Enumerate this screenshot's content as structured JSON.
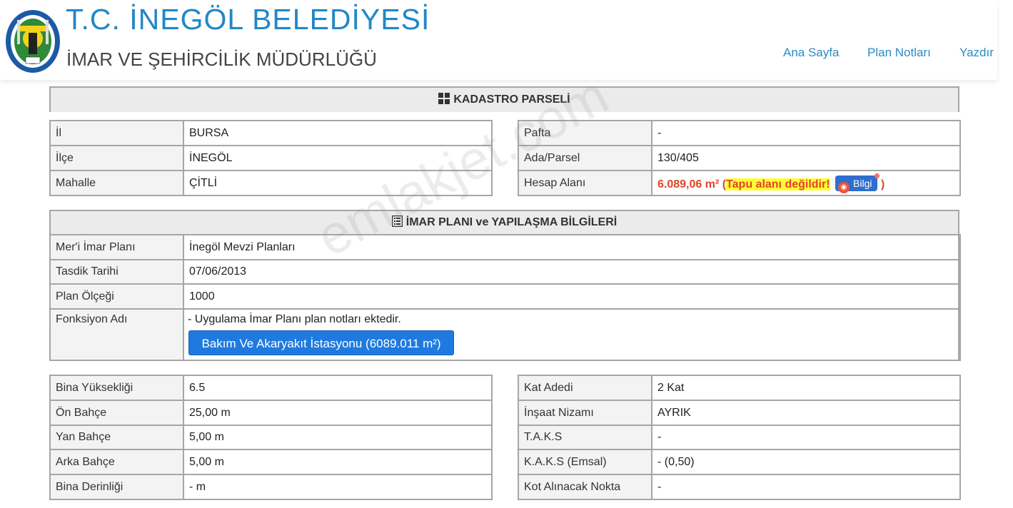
{
  "header": {
    "title": "T.C. İNEGÖL BELEDİYESİ",
    "subtitle": "İMAR VE ŞEHİRCİLİK MÜDÜRLÜĞÜ",
    "logo_text": "İNEGÖL BELEDİYESİ 1870",
    "nav": {
      "home": "Ana Sayfa",
      "notes": "Plan Notları",
      "print": "Yazdır"
    }
  },
  "kadastro": {
    "title": "KADASTRO PARSELİ",
    "left": [
      {
        "label": "İl",
        "value": "BURSA"
      },
      {
        "label": "İlçe",
        "value": "İNEGÖL"
      },
      {
        "label": "Mahalle",
        "value": "ÇİTLİ"
      }
    ],
    "right": {
      "pafta_label": "Pafta",
      "pafta_value": "-",
      "ada_label": "Ada/Parsel",
      "ada_value": "130/405",
      "hesap_label": "Hesap Alanı",
      "hesap_value": "6.089,06 m²",
      "open_paren": "(",
      "warning": "Tapu alanı değildir!",
      "info_button": "Bilgi",
      "close_paren": ")"
    }
  },
  "imar": {
    "title": "İMAR PLANI ve YAPILAŞMA BİLGİLERİ",
    "rows": [
      {
        "label": "Mer'i İmar Planı",
        "value": "İnegöl Mevzi Planları"
      },
      {
        "label": "Tasdik Tarihi",
        "value": "07/06/2013"
      },
      {
        "label": "Plan Ölçeği",
        "value": "1000"
      }
    ],
    "fonksiyon_label": "Fonksiyon Adı",
    "fonksiyon_text": "- Uygulama İmar Planı plan notları ektedir.",
    "fonksiyon_button": "Bakım Ve Akaryakıt İstasyonu (6089.011 m²)"
  },
  "yapilasma": {
    "left": [
      {
        "label": "Bina Yüksekliği",
        "value": "6.5"
      },
      {
        "label": "Ön Bahçe",
        "value": "25,00 m"
      },
      {
        "label": "Yan Bahçe",
        "value": "5,00 m"
      },
      {
        "label": "Arka Bahçe",
        "value": "5,00 m"
      },
      {
        "label": "Bina Derinliği",
        "value": "- m"
      }
    ],
    "right": [
      {
        "label": "Kat Adedi",
        "value": "2 Kat"
      },
      {
        "label": "İnşaat Nizamı",
        "value": "AYRIK"
      },
      {
        "label": "T.A.K.S",
        "value": "-"
      },
      {
        "label": "K.A.K.S (Emsal)",
        "value": "- (0,50)"
      },
      {
        "label": "Kot Alınacak Nokta",
        "value": "-"
      }
    ]
  },
  "watermark": "emlakjet.com",
  "colors": {
    "brand_blue": "#2387c7",
    "button_blue": "#1f7ae0",
    "warning_red": "#e0442a",
    "highlight": "#ffff33"
  }
}
